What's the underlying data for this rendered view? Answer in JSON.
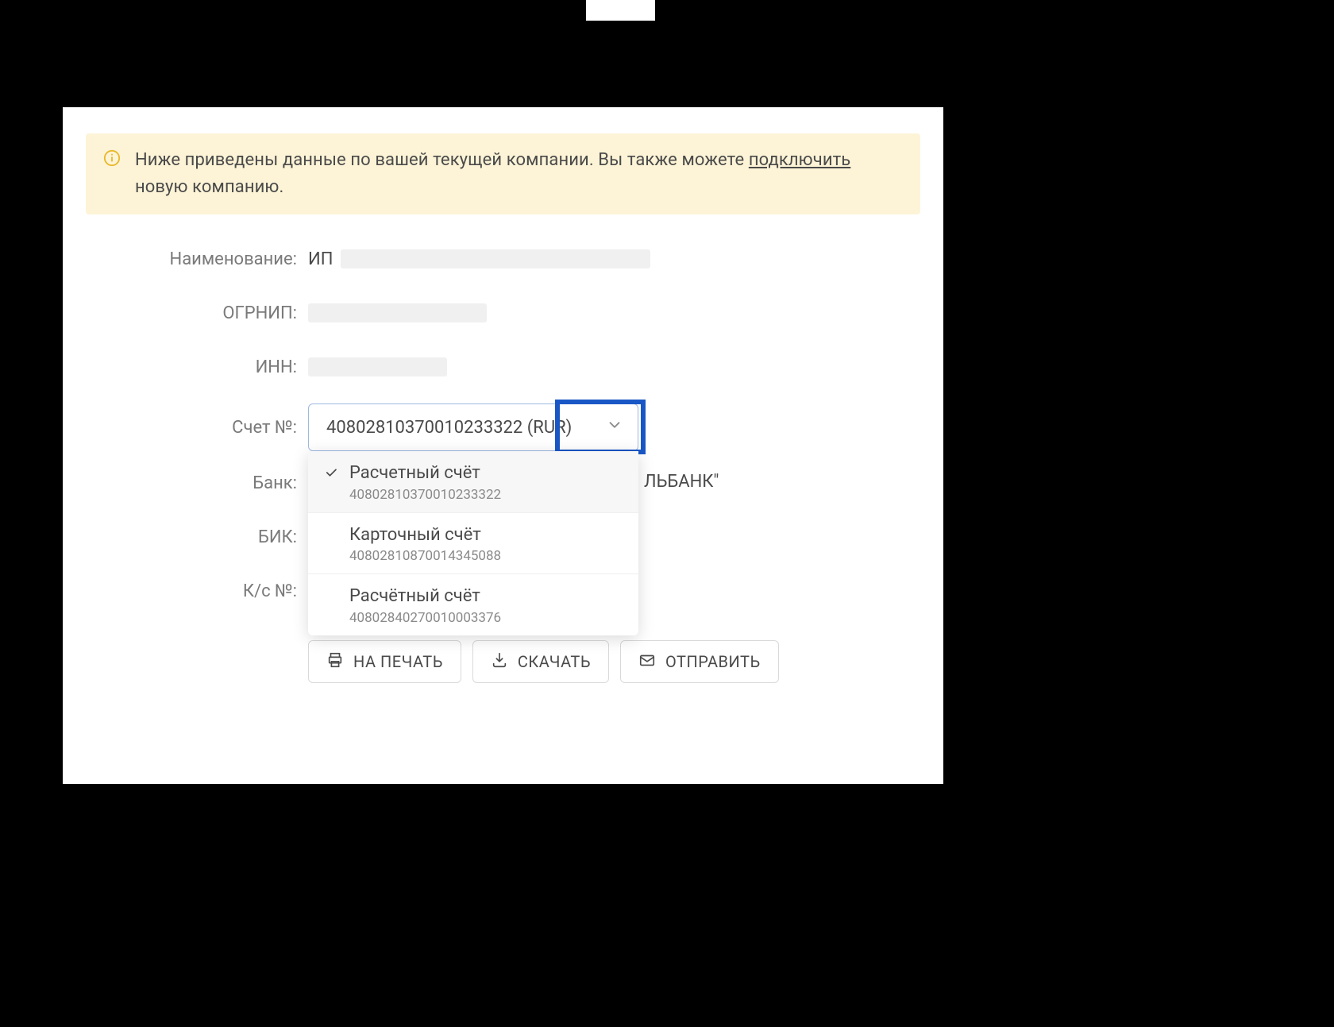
{
  "banner": {
    "text_before": "Ниже приведены данные по вашей текущей компании. Вы также можете ",
    "link_text": "подключить",
    "text_after": " новую компанию."
  },
  "fields": {
    "name_label": "Наименование:",
    "name_value_prefix": "ИП",
    "ogrnip_label": "ОГРНИП:",
    "inn_label": "ИНН:",
    "account_label": "Счет №:",
    "account_selected": "40802810370010233322 (RUR)",
    "bank_label": "Банк:",
    "bank_value_tail": "ЛЬБАНК\"",
    "bik_label": "БИК:",
    "ks_label": "К/с №:"
  },
  "account_options": [
    {
      "title": "Расчетный счёт",
      "sub": "40802810370010233322",
      "selected": true
    },
    {
      "title": "Карточный счёт",
      "sub": "40802810870014345088",
      "selected": false
    },
    {
      "title": "Расчётный счёт",
      "sub": "40802840270010003376",
      "selected": false
    }
  ],
  "actions": {
    "print": "НА ПЕЧАТЬ",
    "download": "СКАЧАТЬ",
    "send": "ОТПРАВИТЬ"
  }
}
